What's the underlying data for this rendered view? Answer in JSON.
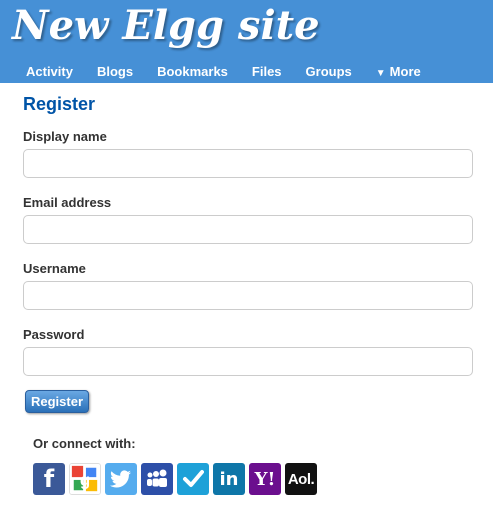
{
  "header": {
    "site_title": "New Elgg site",
    "background_color": "#4690d6",
    "nav": [
      {
        "label": "Activity"
      },
      {
        "label": "Blogs"
      },
      {
        "label": "Bookmarks"
      },
      {
        "label": "Files"
      },
      {
        "label": "Groups"
      },
      {
        "label": "More",
        "icon": "triangle-down-icon"
      }
    ]
  },
  "main": {
    "title": "Register",
    "fields": [
      {
        "label": "Display name",
        "value": ""
      },
      {
        "label": "Email address",
        "value": ""
      },
      {
        "label": "Username",
        "value": ""
      },
      {
        "label": "Password",
        "value": ""
      }
    ],
    "submit_label": "Register"
  },
  "connect": {
    "label": "Or connect with:",
    "providers": [
      {
        "icon": "facebook-icon",
        "color": "#3b5998"
      },
      {
        "icon": "google-icon",
        "color": "#ffffff"
      },
      {
        "icon": "twitter-icon",
        "color": "#55acee"
      },
      {
        "icon": "myspace-icon",
        "color": "#2d4fa8"
      },
      {
        "icon": "foursquare-icon",
        "color": "#1ea1d8"
      },
      {
        "icon": "linkedin-icon",
        "color": "#0e76a8"
      },
      {
        "icon": "yahoo-icon",
        "color": "#6b0f8e",
        "glyph": "Y!"
      },
      {
        "icon": "aol-icon",
        "color": "#111111",
        "glyph": "Aol."
      }
    ]
  }
}
